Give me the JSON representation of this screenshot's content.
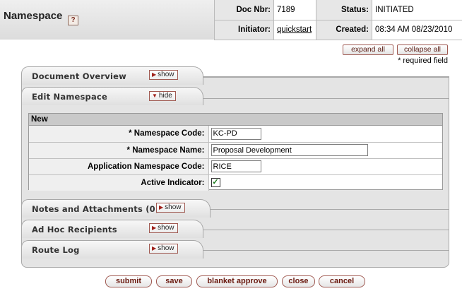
{
  "header": {
    "title": "Namespace",
    "help_glyph": "?",
    "doc_nbr_label": "Doc Nbr:",
    "doc_nbr": "7189",
    "status_label": "Status:",
    "status": "INITIATED",
    "initiator_label": "Initiator:",
    "initiator": "quickstart",
    "created_label": "Created:",
    "created": "08:34 AM 08/23/2010"
  },
  "controls": {
    "expand_all": "expand all",
    "collapse_all": "collapse all",
    "required_note": "* required field"
  },
  "tabs": {
    "document_overview": {
      "label": "Document Overview",
      "toggle": "show"
    },
    "edit_namespace": {
      "label": "Edit Namespace",
      "toggle": "hide"
    },
    "notes": {
      "label": "Notes and Attachments (0)",
      "toggle": "show"
    },
    "ad_hoc": {
      "label": "Ad Hoc Recipients",
      "toggle": "show"
    },
    "route_log": {
      "label": "Route Log",
      "toggle": "show"
    }
  },
  "edit_namespace": {
    "section_header": "New",
    "code_label": "*  Namespace Code:",
    "code_value": "KC-PD",
    "name_label": "*  Namespace Name:",
    "name_value": "Proposal Development",
    "app_label": "Application Namespace Code:",
    "app_value": "RICE",
    "active_label": "Active Indicator:",
    "active_checked": true,
    "check_glyph": "✓"
  },
  "actions": {
    "submit": "submit",
    "save": "save",
    "blanket_approve": "blanket approve",
    "close": "close",
    "cancel": "cancel"
  },
  "colors": {
    "button_border": "#a05a52",
    "button_text": "#6a1a10",
    "panel_bg": "#e4e4e4"
  }
}
